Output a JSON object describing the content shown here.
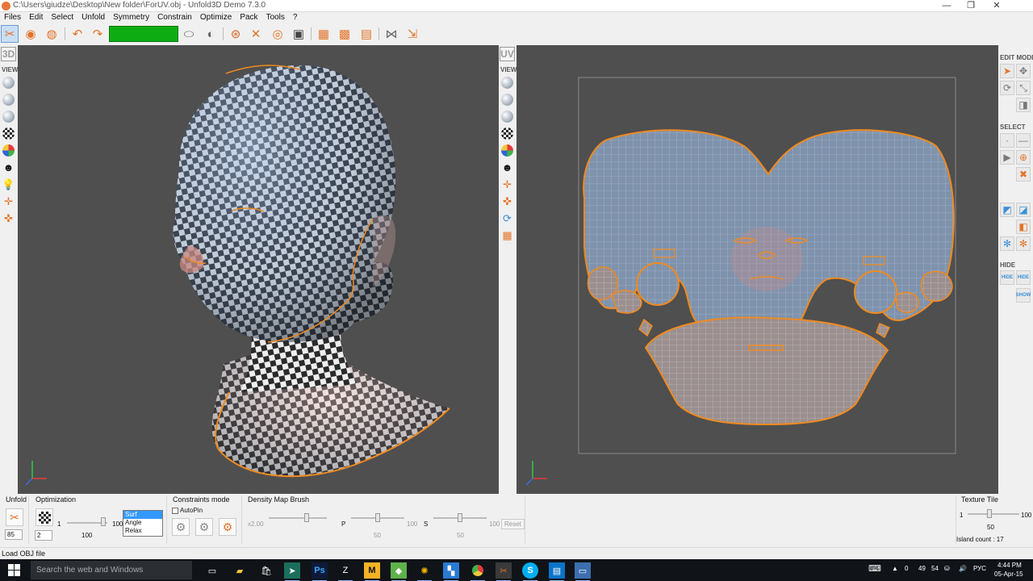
{
  "window": {
    "title": "C:\\Users\\giudze\\Desktop\\New folder\\ForUV.obj - Unfold3D Demo 7.3.0",
    "minimize": "—",
    "maximize": "❐",
    "close": "✕"
  },
  "menu": [
    "Files",
    "Edit",
    "Select",
    "Unfold",
    "Symmetry",
    "Constrain",
    "Optimize",
    "Pack",
    "Tools",
    "?"
  ],
  "left_toolbar": {
    "badge": "3D",
    "view_label": "VIEW"
  },
  "uv_toolbar": {
    "badge": "UV",
    "view_label": "VIEW"
  },
  "right_panel": {
    "edit_mode_label": "EDIT MODE",
    "select_label": "SELECT",
    "hide_label": "HIDE",
    "hide_btn": "HIDE",
    "show_btn": "SHOW"
  },
  "bottom": {
    "unfold": {
      "title": "Unfold",
      "value": "85"
    },
    "optimization": {
      "title": "Optimization",
      "iter_value": "1",
      "slider_min": "1",
      "slider_max": "100",
      "slider_value": "100",
      "second_value": "2",
      "options": [
        "Surf",
        "Angle",
        "Relax"
      ],
      "selected": "Surf"
    },
    "constraints": {
      "title": "Constraints mode",
      "autopin": "AutoPin"
    },
    "density": {
      "title": "Density Map Brush",
      "x_label": "x2.00",
      "p_label": "P",
      "p_max": "100",
      "p_value": "50",
      "s_label": "S",
      "s_max": "100",
      "s_value": "50",
      "reset": "Reset"
    },
    "texture_tile": {
      "title": "Texture Tile",
      "min": "1",
      "max": "100",
      "value": "50",
      "island_count": "Island count : 17"
    }
  },
  "status": "Load OBJ file",
  "taskbar": {
    "search_placeholder": "Search the web and Windows",
    "tray_values": [
      "0",
      "49",
      "54"
    ],
    "language": "РУС",
    "time": "4:44 PM",
    "date": "05-Apr-15"
  },
  "colors": {
    "viewport_bg": "#4f4f4f",
    "uv_border": "#f08a1e",
    "uv_fill": "#7f93ad",
    "progress": "#0eac13",
    "taskbar": "#101418"
  }
}
